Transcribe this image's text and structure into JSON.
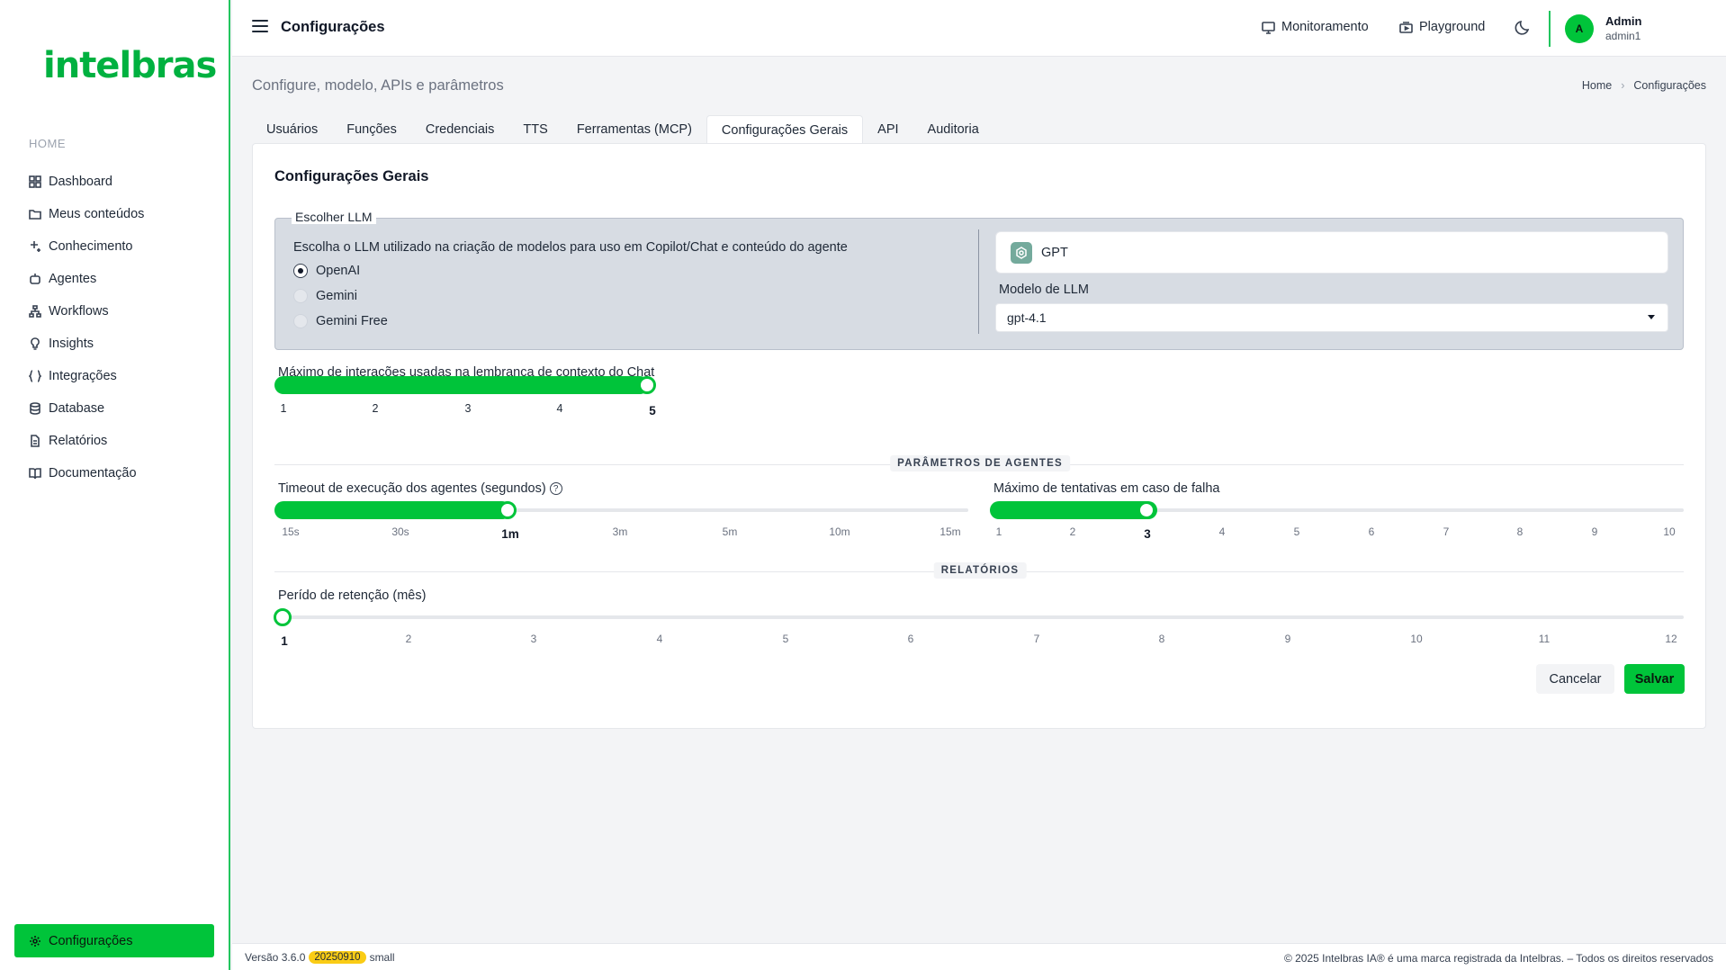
{
  "brand": {
    "logo": "intelbras",
    "color": "#00c43a"
  },
  "sidebar": {
    "section": "HOME",
    "items": [
      {
        "label": "Dashboard",
        "icon": "grid-icon"
      },
      {
        "label": "Meus conteúdos",
        "icon": "folder-icon"
      },
      {
        "label": "Conhecimento",
        "icon": "sparkle-icon"
      },
      {
        "label": "Agentes",
        "icon": "bot-icon"
      },
      {
        "label": "Workflows",
        "icon": "workflow-icon"
      },
      {
        "label": "Insights",
        "icon": "lightbulb-icon"
      },
      {
        "label": "Integrações",
        "icon": "braces-icon"
      },
      {
        "label": "Database",
        "icon": "database-icon"
      },
      {
        "label": "Relatórios",
        "icon": "file-icon"
      },
      {
        "label": "Documentação",
        "icon": "book-icon"
      }
    ],
    "active": {
      "label": "Configurações",
      "icon": "gear-icon"
    }
  },
  "topbar": {
    "title": "Configurações",
    "monitor_label": "Monitoramento",
    "playground_label": "Playground",
    "avatar_initial": "A",
    "user_name": "Admin",
    "user_login": "admin1"
  },
  "page": {
    "subtitle": "Configure, modelo, APIs e parâmetros",
    "breadcrumb": [
      "Home",
      "Configurações"
    ]
  },
  "tabs": [
    "Usuários",
    "Funções",
    "Credenciais",
    "TTS",
    "Ferramentas (MCP)",
    "Configurações Gerais",
    "API",
    "Auditoria"
  ],
  "active_tab": "Configurações Gerais",
  "card": {
    "title": "Configurações Gerais",
    "llm": {
      "legend": "Escolher LLM",
      "description": "Escolha o LLM utilizado na criação de modelos para uso em Copilot/Chat e conteúdo do agente",
      "options": [
        "OpenAI",
        "Gemini",
        "Gemini Free"
      ],
      "selected": "OpenAI",
      "provider_name": "GPT",
      "model_label": "Modelo de LLM",
      "model_value": "gpt-4.1"
    },
    "context_slider": {
      "label": "Máximo de interações usadas na lembrança de contexto do Chat",
      "ticks": [
        "1",
        "2",
        "3",
        "4",
        "5"
      ],
      "value": "5"
    },
    "agents_section": "PARÂMETROS DE AGENTES",
    "timeout_slider": {
      "label": "Timeout de execução dos agentes (segundos)",
      "ticks": [
        "15s",
        "30s",
        "1m",
        "3m",
        "5m",
        "10m",
        "15m"
      ],
      "value": "1m"
    },
    "retries_slider": {
      "label": "Máximo de tentativas em caso de falha",
      "ticks": [
        "1",
        "2",
        "3",
        "4",
        "5",
        "6",
        "7",
        "8",
        "9",
        "10"
      ],
      "value": "3"
    },
    "reports_section": "RELATÓRIOS",
    "retention_slider": {
      "label": "Perído de retenção (mês)",
      "ticks": [
        "1",
        "2",
        "3",
        "4",
        "5",
        "6",
        "7",
        "8",
        "9",
        "10",
        "11",
        "12"
      ],
      "value": "1"
    },
    "cancel_label": "Cancelar",
    "save_label": "Salvar"
  },
  "footer": {
    "version_label": "Versão 3.6.0",
    "build": "20250910",
    "size": "small",
    "copyright": "© 2025 Intelbras IA® é uma marca registrada da Intelbras. – Todos os direitos reservados"
  }
}
